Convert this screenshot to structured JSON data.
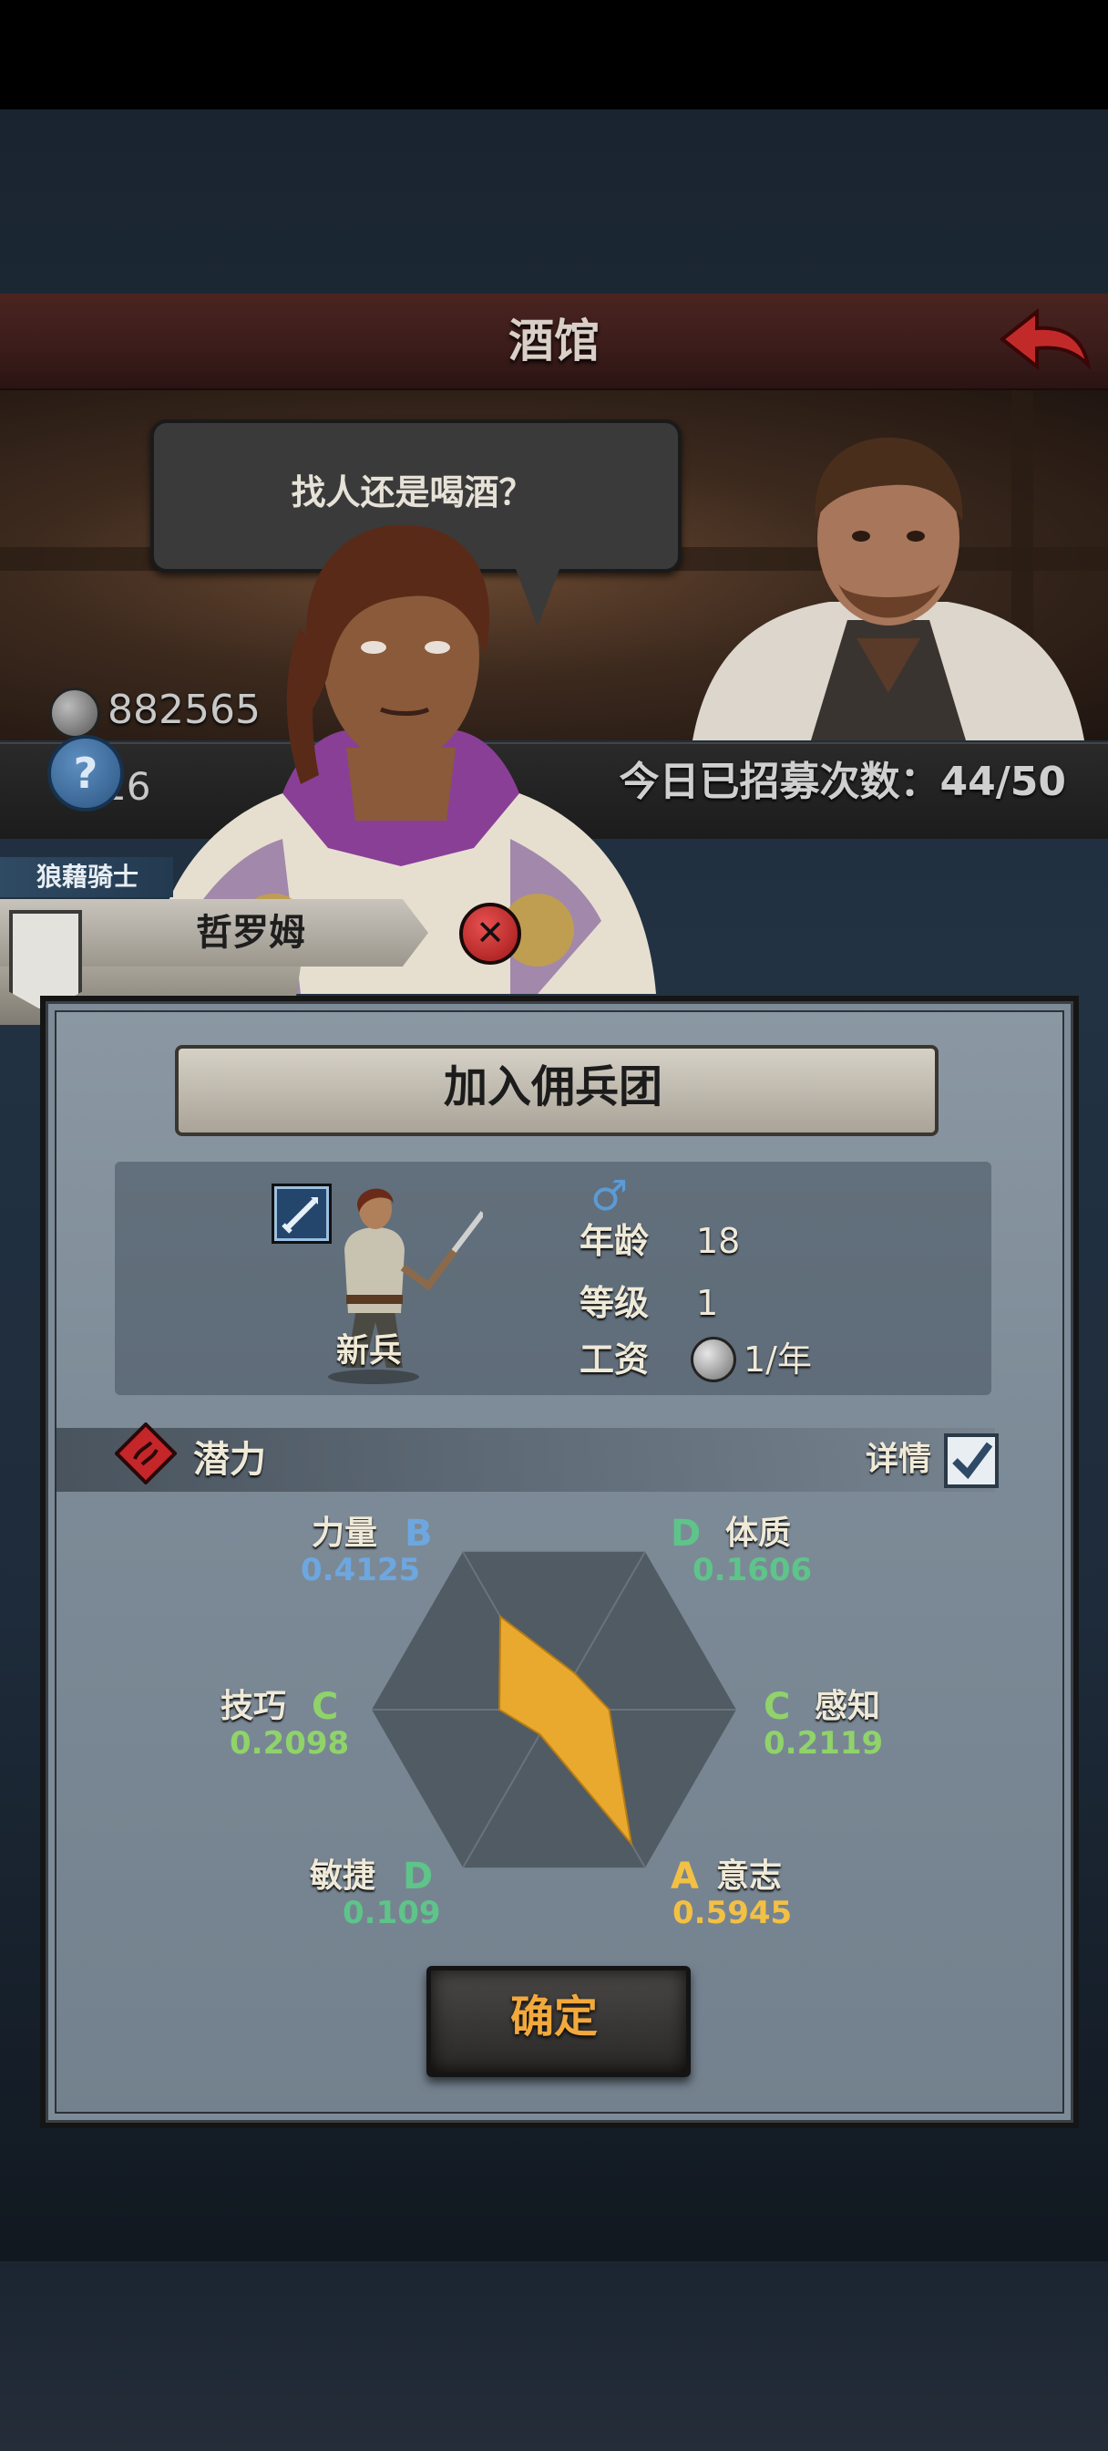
{
  "tavern": {
    "title": "酒馆",
    "greeting": "找人还是喝酒？"
  },
  "resources": {
    "silver": "882565",
    "food": "16",
    "help_glyph": "?",
    "recruit_count": "今日已招募次数：44/50"
  },
  "hero": {
    "class_tag": "狼藉骑士",
    "name": "哲罗姆",
    "dismiss_glyph": "✕"
  },
  "panel": {
    "title": "加入佣兵团",
    "unit_class": "新兵",
    "gender_icon": "male-icon",
    "stats": {
      "age_label": "年龄",
      "age": "18",
      "level_label": "等级",
      "level": "1",
      "wage_label": "工资",
      "wage": "1/年"
    },
    "potential_label": "潜力",
    "details_label": "详情",
    "details_checked": true,
    "confirm_label": "确定"
  },
  "grade_colors": {
    "A": "#f2c044",
    "B": "#6da7e0",
    "C": "#8fd36a",
    "D": "#5ec48a"
  },
  "chart_data": {
    "type": "radar",
    "axes": [
      {
        "name": "力量",
        "grade": "B",
        "value": 0.4125,
        "value_label": "0.4125"
      },
      {
        "name": "体质",
        "grade": "D",
        "value": 0.1606,
        "value_label": "0.1606"
      },
      {
        "name": "感知",
        "grade": "C",
        "value": 0.2119,
        "value_label": "0.2119"
      },
      {
        "name": "意志",
        "grade": "A",
        "value": 0.5945,
        "value_label": "0.5945"
      },
      {
        "name": "敏捷",
        "grade": "D",
        "value": 0.109,
        "value_label": "0.109"
      },
      {
        "name": "技巧",
        "grade": "C",
        "value": 0.2098,
        "value_label": "0.2098"
      }
    ],
    "range": [
      0,
      0.7
    ],
    "fill_color": "#e8a92e"
  }
}
